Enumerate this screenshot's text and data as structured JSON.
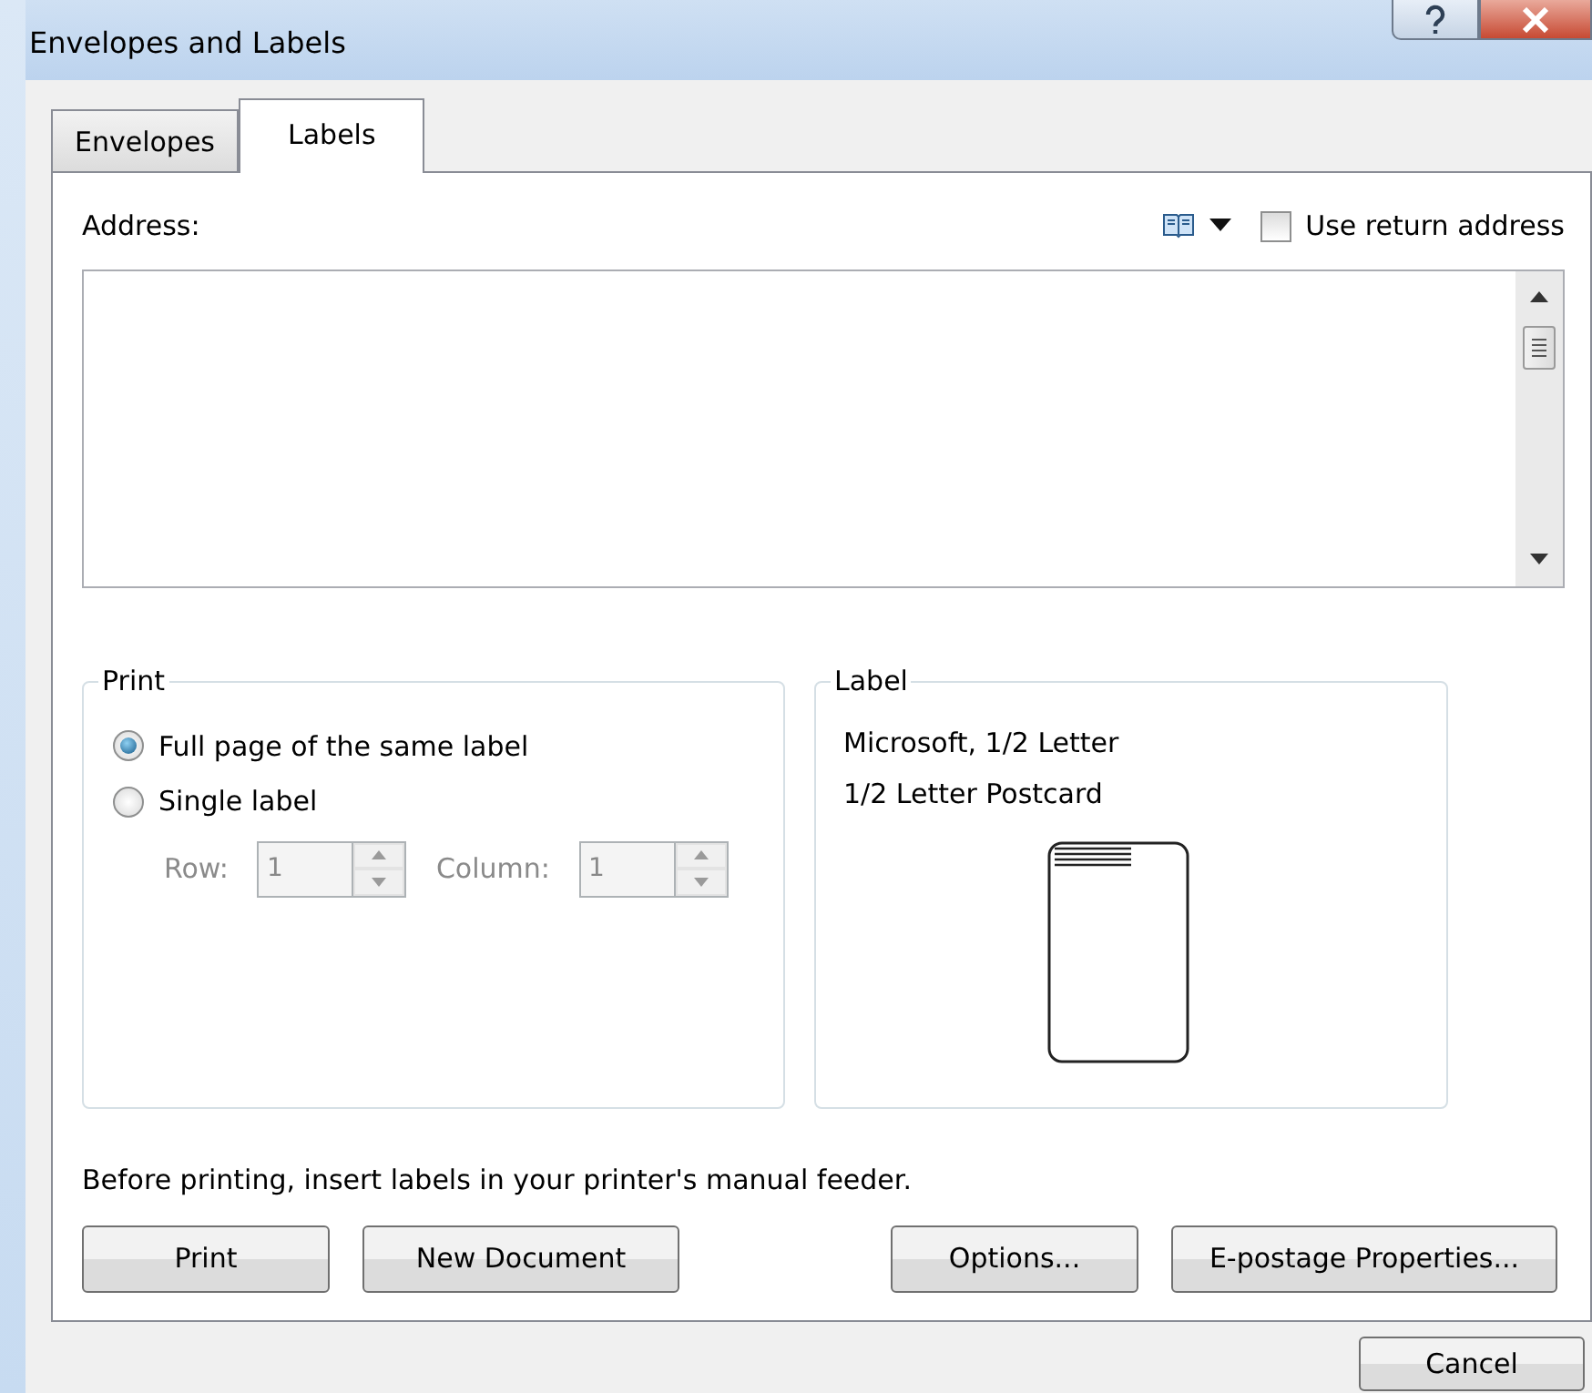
{
  "window": {
    "title": "Envelopes and Labels"
  },
  "tabs": [
    {
      "label": "Envelopes",
      "selected": false
    },
    {
      "label": "Labels",
      "selected": true
    }
  ],
  "address": {
    "label": "Address:"
  },
  "return_address": {
    "label": "Use return address",
    "checked": false
  },
  "print_group": {
    "title": "Print",
    "options": [
      {
        "label": "Full page of the same label",
        "selected": true
      },
      {
        "label": "Single label",
        "selected": false
      }
    ],
    "fields": [
      {
        "label": "Row:",
        "value": "1",
        "disabled": true
      },
      {
        "label": "Column:",
        "value": "1",
        "disabled": true
      }
    ]
  },
  "label_group": {
    "title": "Label",
    "lines": [
      "Microsoft, 1/2 Letter",
      "1/2 Letter Postcard"
    ]
  },
  "note": "Before printing, insert labels in your printer's manual feeder.",
  "buttons": [
    {
      "label": "Print"
    },
    {
      "label": "New Document"
    },
    {
      "label": "Options..."
    },
    {
      "label": "E-postage Properties..."
    }
  ],
  "footer_buttons": [
    {
      "label": "Cancel"
    }
  ]
}
